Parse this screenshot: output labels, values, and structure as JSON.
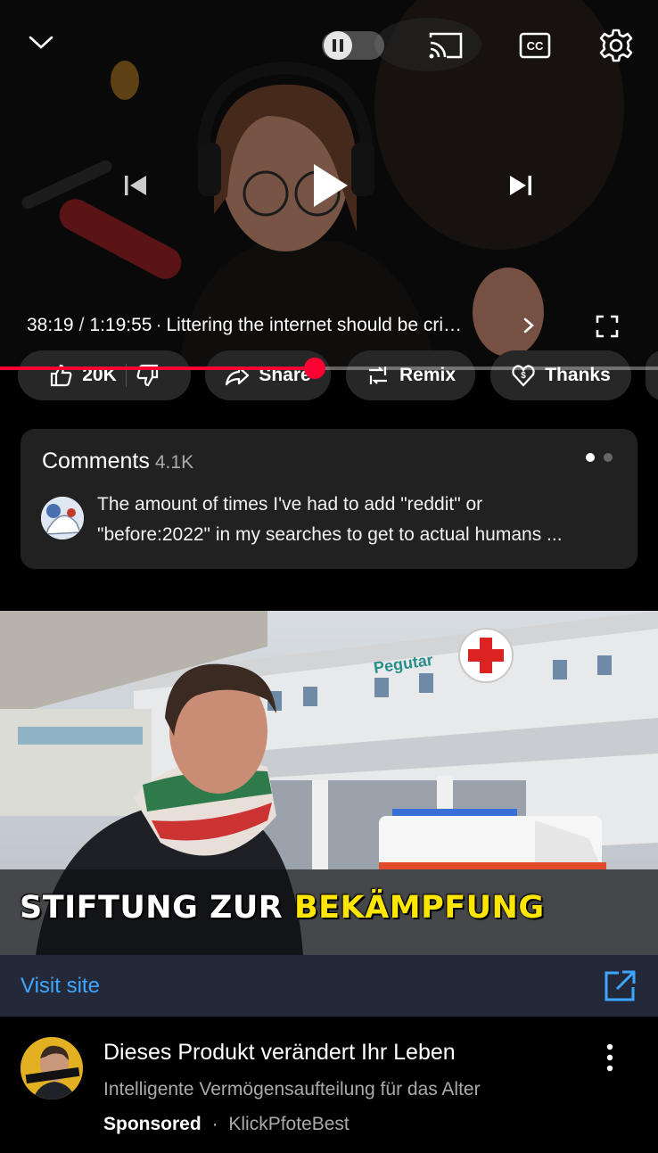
{
  "player": {
    "current_time": "38:19",
    "separator": "/",
    "duration": "1:19:55",
    "title_prefix": "·",
    "video_title": "Littering the internet should be cri…",
    "progress_fraction": 0.478,
    "colors": {
      "progress": "#ff0033",
      "background": "#000000"
    },
    "icons": [
      "chevron-down-icon",
      "pause-icon",
      "cast-icon",
      "captions-icon",
      "settings-icon",
      "previous-icon",
      "play-icon",
      "next-icon",
      "chevron-right-icon",
      "fullscreen-icon"
    ]
  },
  "actions": {
    "like_count": "20K",
    "share_label": "Share",
    "remix_label": "Remix",
    "thanks_label": "Thanks"
  },
  "comments": {
    "title": "Comments",
    "count": "4.1K",
    "top_comment_line1": "The amount of times I've had to add \"reddit\" or",
    "top_comment_line2": "\"before:2022\" in my searches to get to actual humans ..."
  },
  "ad": {
    "image_caption_white": "STIFTUNG ZUR",
    "image_caption_yellow": "BEKÄMPFUNG",
    "visit_label": "Visit site",
    "title": "Dieses Produkt verändert Ihr Leben",
    "description": "Intelligente Vermögensaufteilung für das Alter",
    "sponsored_label": "Sponsored",
    "meta_separator": "·",
    "advertiser": "KlickPfoteBest",
    "colors": {
      "link": "#3ea6ff",
      "visit_bar": "#24293a",
      "caption_highlight": "#ffe600"
    }
  }
}
